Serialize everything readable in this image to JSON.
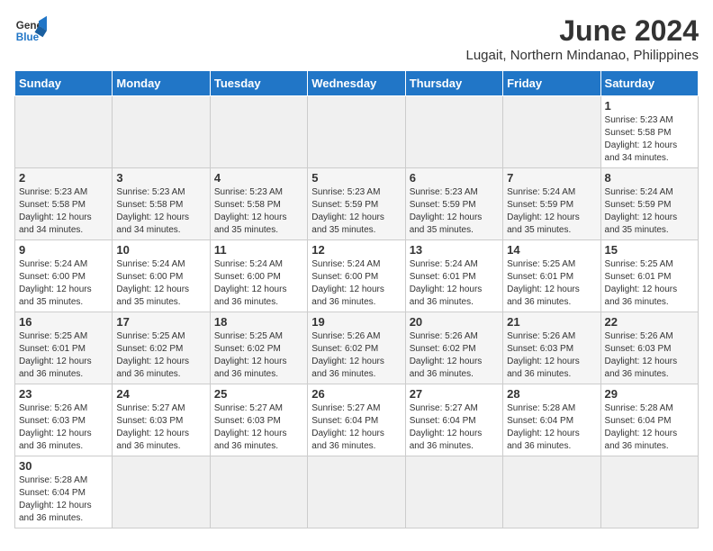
{
  "header": {
    "logo_general": "General",
    "logo_blue": "Blue",
    "title": "June 2024",
    "subtitle": "Lugait, Northern Mindanao, Philippines"
  },
  "weekdays": [
    "Sunday",
    "Monday",
    "Tuesday",
    "Wednesday",
    "Thursday",
    "Friday",
    "Saturday"
  ],
  "weeks": [
    [
      {
        "day": "",
        "info": ""
      },
      {
        "day": "",
        "info": ""
      },
      {
        "day": "",
        "info": ""
      },
      {
        "day": "",
        "info": ""
      },
      {
        "day": "",
        "info": ""
      },
      {
        "day": "",
        "info": ""
      },
      {
        "day": "1",
        "info": "Sunrise: 5:23 AM\nSunset: 5:58 PM\nDaylight: 12 hours and 34 minutes."
      }
    ],
    [
      {
        "day": "2",
        "info": "Sunrise: 5:23 AM\nSunset: 5:58 PM\nDaylight: 12 hours and 34 minutes."
      },
      {
        "day": "3",
        "info": "Sunrise: 5:23 AM\nSunset: 5:58 PM\nDaylight: 12 hours and 34 minutes."
      },
      {
        "day": "4",
        "info": "Sunrise: 5:23 AM\nSunset: 5:58 PM\nDaylight: 12 hours and 35 minutes."
      },
      {
        "day": "5",
        "info": "Sunrise: 5:23 AM\nSunset: 5:59 PM\nDaylight: 12 hours and 35 minutes."
      },
      {
        "day": "6",
        "info": "Sunrise: 5:23 AM\nSunset: 5:59 PM\nDaylight: 12 hours and 35 minutes."
      },
      {
        "day": "7",
        "info": "Sunrise: 5:24 AM\nSunset: 5:59 PM\nDaylight: 12 hours and 35 minutes."
      },
      {
        "day": "8",
        "info": "Sunrise: 5:24 AM\nSunset: 5:59 PM\nDaylight: 12 hours and 35 minutes."
      }
    ],
    [
      {
        "day": "9",
        "info": "Sunrise: 5:24 AM\nSunset: 6:00 PM\nDaylight: 12 hours and 35 minutes."
      },
      {
        "day": "10",
        "info": "Sunrise: 5:24 AM\nSunset: 6:00 PM\nDaylight: 12 hours and 35 minutes."
      },
      {
        "day": "11",
        "info": "Sunrise: 5:24 AM\nSunset: 6:00 PM\nDaylight: 12 hours and 36 minutes."
      },
      {
        "day": "12",
        "info": "Sunrise: 5:24 AM\nSunset: 6:00 PM\nDaylight: 12 hours and 36 minutes."
      },
      {
        "day": "13",
        "info": "Sunrise: 5:24 AM\nSunset: 6:01 PM\nDaylight: 12 hours and 36 minutes."
      },
      {
        "day": "14",
        "info": "Sunrise: 5:25 AM\nSunset: 6:01 PM\nDaylight: 12 hours and 36 minutes."
      },
      {
        "day": "15",
        "info": "Sunrise: 5:25 AM\nSunset: 6:01 PM\nDaylight: 12 hours and 36 minutes."
      }
    ],
    [
      {
        "day": "16",
        "info": "Sunrise: 5:25 AM\nSunset: 6:01 PM\nDaylight: 12 hours and 36 minutes."
      },
      {
        "day": "17",
        "info": "Sunrise: 5:25 AM\nSunset: 6:02 PM\nDaylight: 12 hours and 36 minutes."
      },
      {
        "day": "18",
        "info": "Sunrise: 5:25 AM\nSunset: 6:02 PM\nDaylight: 12 hours and 36 minutes."
      },
      {
        "day": "19",
        "info": "Sunrise: 5:26 AM\nSunset: 6:02 PM\nDaylight: 12 hours and 36 minutes."
      },
      {
        "day": "20",
        "info": "Sunrise: 5:26 AM\nSunset: 6:02 PM\nDaylight: 12 hours and 36 minutes."
      },
      {
        "day": "21",
        "info": "Sunrise: 5:26 AM\nSunset: 6:03 PM\nDaylight: 12 hours and 36 minutes."
      },
      {
        "day": "22",
        "info": "Sunrise: 5:26 AM\nSunset: 6:03 PM\nDaylight: 12 hours and 36 minutes."
      }
    ],
    [
      {
        "day": "23",
        "info": "Sunrise: 5:26 AM\nSunset: 6:03 PM\nDaylight: 12 hours and 36 minutes."
      },
      {
        "day": "24",
        "info": "Sunrise: 5:27 AM\nSunset: 6:03 PM\nDaylight: 12 hours and 36 minutes."
      },
      {
        "day": "25",
        "info": "Sunrise: 5:27 AM\nSunset: 6:03 PM\nDaylight: 12 hours and 36 minutes."
      },
      {
        "day": "26",
        "info": "Sunrise: 5:27 AM\nSunset: 6:04 PM\nDaylight: 12 hours and 36 minutes."
      },
      {
        "day": "27",
        "info": "Sunrise: 5:27 AM\nSunset: 6:04 PM\nDaylight: 12 hours and 36 minutes."
      },
      {
        "day": "28",
        "info": "Sunrise: 5:28 AM\nSunset: 6:04 PM\nDaylight: 12 hours and 36 minutes."
      },
      {
        "day": "29",
        "info": "Sunrise: 5:28 AM\nSunset: 6:04 PM\nDaylight: 12 hours and 36 minutes."
      }
    ],
    [
      {
        "day": "30",
        "info": "Sunrise: 5:28 AM\nSunset: 6:04 PM\nDaylight: 12 hours and 36 minutes."
      },
      {
        "day": "",
        "info": ""
      },
      {
        "day": "",
        "info": ""
      },
      {
        "day": "",
        "info": ""
      },
      {
        "day": "",
        "info": ""
      },
      {
        "day": "",
        "info": ""
      },
      {
        "day": "",
        "info": ""
      }
    ]
  ]
}
